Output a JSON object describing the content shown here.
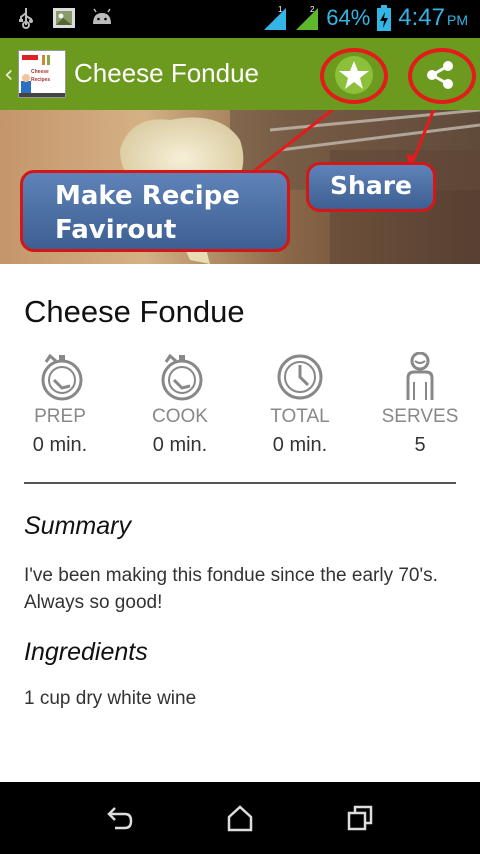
{
  "status_bar": {
    "battery_percent": "64%",
    "time": "4:47",
    "ampm": "PM",
    "icons": [
      "usb-icon",
      "image-notification-icon",
      "android-icon",
      "signal-1-icon",
      "signal-2-icon",
      "battery-charging-icon"
    ]
  },
  "action_bar": {
    "title": "Cheese Fondue",
    "logo_text": "Cheese Recipes",
    "favorite_icon": "star-icon",
    "share_icon": "share-icon",
    "color": "#6b9a1f"
  },
  "annotations": {
    "favorite_callout": "Make Recipe Favirout",
    "share_callout": "Share",
    "highlight_color": "#e21b1b"
  },
  "recipe": {
    "title": "Cheese Fondue",
    "stats": [
      {
        "label": "PREP",
        "value": "0 min.",
        "icon": "stopwatch-icon"
      },
      {
        "label": "COOK",
        "value": "0 min.",
        "icon": "stopwatch-icon"
      },
      {
        "label": "TOTAL",
        "value": "0 min.",
        "icon": "clock-icon"
      },
      {
        "label": "SERVES",
        "value": "5",
        "icon": "person-icon"
      }
    ],
    "summary_heading": "Summary",
    "summary": "I've been making this fondue since the early 70's. Always so good!",
    "ingredients_heading": "Ingredients",
    "ingredients": [
      "1 cup dry white wine"
    ]
  },
  "nav_bar": {
    "icons": [
      "back-icon",
      "home-icon",
      "recent-apps-icon"
    ]
  }
}
